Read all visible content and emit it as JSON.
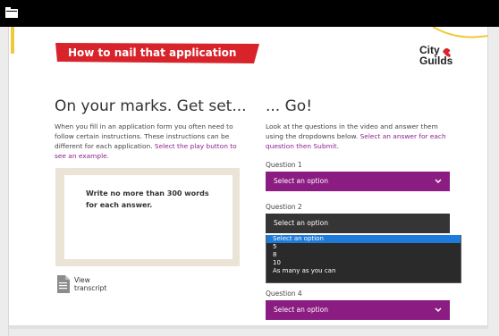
{
  "banner": {
    "title": "How to nail that application"
  },
  "logo": {
    "line1": "City",
    "line2": "Guilds"
  },
  "left": {
    "heading": "On your marks. Get set...",
    "paragraph": "When you fill in an application form you often need to follow certain instructions. These instructions can be different for each application. ",
    "paragraph_link": "Select the play button to see an example.",
    "video_text": "Write no more than 300 words for each answer.",
    "view_line1": "View",
    "view_line2": "transcript"
  },
  "right": {
    "heading": "... Go!",
    "paragraph": "Look at the questions in the video and answer them using the dropdowns below. ",
    "paragraph_link": "Select an answer for each question then Submit."
  },
  "questions": [
    {
      "label": "Question 1",
      "selected": "Select an option"
    },
    {
      "label": "Question 2",
      "selected": "Select an option"
    },
    {
      "label": "Question 4",
      "selected": "Select an option"
    }
  ],
  "dropdown_options": [
    "Select an option",
    "5",
    "8",
    "10",
    "As many as you can"
  ],
  "colors": {
    "banner_red": "#d8232a",
    "select_purple": "#8b1d82",
    "select_dark": "#353535",
    "option_highlight": "#1e7bd9",
    "link_purple": "#8a1f8f"
  },
  "icons": [
    "folder-icon",
    "chevron-down-icon",
    "document-icon",
    "logo-mark-icon"
  ]
}
